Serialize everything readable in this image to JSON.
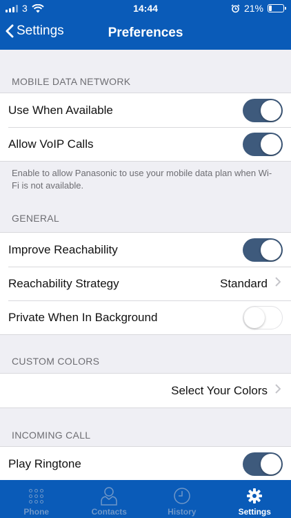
{
  "status_bar": {
    "carrier": "3",
    "time": "14:44",
    "battery": "21%",
    "battery_level": 0.21
  },
  "nav": {
    "back_label": "Settings",
    "title": "Preferences"
  },
  "sections": {
    "mobile_data": {
      "header": "MOBILE DATA NETWORK",
      "use_when_available": {
        "label": "Use When Available",
        "on": true
      },
      "allow_voip": {
        "label": "Allow VoIP Calls",
        "on": true
      },
      "footer": "Enable to allow Panasonic to use your mobile data plan when Wi-Fi is not available."
    },
    "general": {
      "header": "GENERAL",
      "improve_reachability": {
        "label": "Improve Reachability",
        "on": true
      },
      "reachability_strategy": {
        "label": "Reachability Strategy",
        "value": "Standard"
      },
      "private_background": {
        "label": "Private When In Background",
        "on": false
      }
    },
    "custom_colors": {
      "header": "CUSTOM COLORS",
      "select_colors": {
        "label": "Select Your Colors"
      }
    },
    "incoming_call": {
      "header": "INCOMING CALL",
      "play_ringtone": {
        "label": "Play Ringtone",
        "on": true
      }
    }
  },
  "tabbar": {
    "tabs": [
      {
        "label": "Phone",
        "icon": "dialpad-icon",
        "active": false
      },
      {
        "label": "Contacts",
        "icon": "person-icon",
        "active": false
      },
      {
        "label": "History",
        "icon": "clock-icon",
        "active": false
      },
      {
        "label": "Settings",
        "icon": "gear-icon",
        "active": true
      }
    ]
  },
  "colors": {
    "brand_blue": "#0a5bb8",
    "toggle_on": "#3e5a7c",
    "tab_inactive": "#6f97c8"
  }
}
